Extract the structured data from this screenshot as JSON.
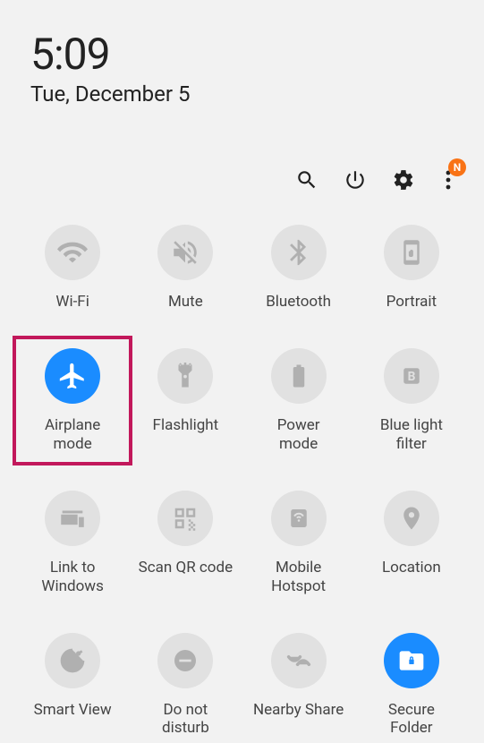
{
  "status": {
    "time": "5:09",
    "date": "Tue, December 5"
  },
  "actions": {
    "search": "Search",
    "power": "Power",
    "settings": "Settings",
    "more": "More",
    "badge": "N"
  },
  "colors": {
    "accent": "#1a8cff",
    "highlight": "#c2185b",
    "badge": "#f97316"
  },
  "tiles": [
    {
      "id": "wifi",
      "label": "Wi-Fi",
      "active": false,
      "highlighted": false
    },
    {
      "id": "mute",
      "label": "Mute",
      "active": false,
      "highlighted": false
    },
    {
      "id": "bluetooth",
      "label": "Bluetooth",
      "active": false,
      "highlighted": false
    },
    {
      "id": "portrait",
      "label": "Portrait",
      "active": false,
      "highlighted": false
    },
    {
      "id": "airplane",
      "label": "Airplane\nmode",
      "active": true,
      "highlighted": true
    },
    {
      "id": "flashlight",
      "label": "Flashlight",
      "active": false,
      "highlighted": false
    },
    {
      "id": "power-mode",
      "label": "Power\nmode",
      "active": false,
      "highlighted": false
    },
    {
      "id": "blue-light",
      "label": "Blue light\nfilter",
      "active": false,
      "highlighted": false
    },
    {
      "id": "link-windows",
      "label": "Link to\nWindows",
      "active": false,
      "highlighted": false
    },
    {
      "id": "scan-qr",
      "label": "Scan QR code",
      "active": false,
      "highlighted": false
    },
    {
      "id": "hotspot",
      "label": "Mobile\nHotspot",
      "active": false,
      "highlighted": false
    },
    {
      "id": "location",
      "label": "Location",
      "active": false,
      "highlighted": false
    },
    {
      "id": "smartview",
      "label": "Smart View",
      "active": false,
      "highlighted": false
    },
    {
      "id": "dnd",
      "label": "Do not\ndisturb",
      "active": false,
      "highlighted": false
    },
    {
      "id": "nearby",
      "label": "Nearby Share",
      "active": false,
      "highlighted": false
    },
    {
      "id": "secure",
      "label": "Secure\nFolder",
      "active": true,
      "highlighted": false
    }
  ]
}
